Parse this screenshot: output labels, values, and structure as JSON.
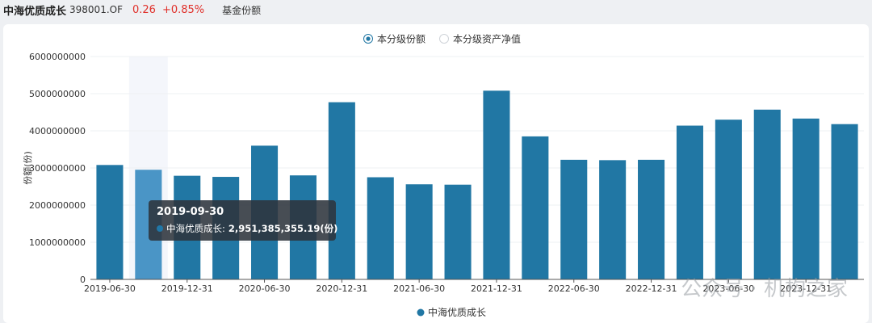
{
  "header": {
    "fund_name": "中海优质成长",
    "fund_code": "398001.OF",
    "price": "0.26",
    "change": "+0.85%",
    "data_label": "基金份额"
  },
  "toggle": {
    "options": [
      {
        "label": "本分级份额",
        "selected": true
      },
      {
        "label": "本分级资产净值",
        "selected": false
      }
    ]
  },
  "tooltip": {
    "date": "2019-09-30",
    "series": "中海优质成长:",
    "value": "2,951,385,355.19(份)"
  },
  "watermark": "公众号 · 机构之家",
  "colors": {
    "bar": "#2177a4",
    "bar_highlight": "#4a95c6",
    "tooltip_bg": "#2d343c",
    "price": "#e0302a"
  },
  "chart_data": {
    "type": "bar",
    "ylabel": "份额(份)",
    "ylim": [
      0,
      6000000000
    ],
    "yticks": [
      "0",
      "1000000000",
      "2000000000",
      "3000000000",
      "4000000000",
      "5000000000",
      "6000000000"
    ],
    "categories": [
      "2019-06-30",
      "2019-09-30",
      "2019-12-31",
      "2020-03-31",
      "2020-06-30",
      "2020-09-30",
      "2020-12-31",
      "2021-03-31",
      "2021-06-30",
      "2021-09-30",
      "2021-12-31",
      "2022-03-31",
      "2022-06-30",
      "2022-09-30",
      "2022-12-31",
      "2023-03-31",
      "2023-06-30",
      "2023-09-30",
      "2023-12-31",
      "2024-03-31"
    ],
    "xtick_labels": [
      "2019-06-30",
      "2019-12-31",
      "2020-06-30",
      "2020-12-31",
      "2021-06-30",
      "2021-12-31",
      "2022-06-30",
      "2022-12-31",
      "2023-06-30",
      "2023-12-31"
    ],
    "series": [
      {
        "name": "中海优质成长",
        "values": [
          3080000000,
          2951385355.19,
          2790000000,
          2760000000,
          3600000000,
          2800000000,
          4770000000,
          2750000000,
          2560000000,
          2550000000,
          5080000000,
          3850000000,
          3220000000,
          3210000000,
          3220000000,
          4140000000,
          4300000000,
          4570000000,
          4330000000,
          4180000000
        ]
      }
    ],
    "highlight_index": 1,
    "legend": "bottom-center",
    "grid": true
  }
}
